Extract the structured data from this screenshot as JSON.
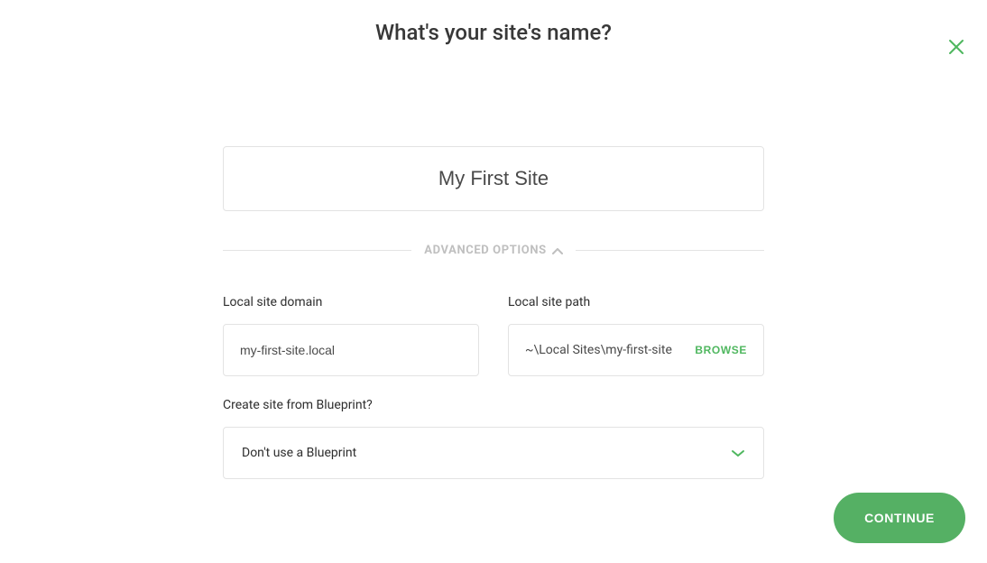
{
  "title": "What's your site's name?",
  "site_name": "My First Site",
  "advanced_label": "ADVANCED OPTIONS",
  "domain": {
    "label": "Local site domain",
    "value": "my-first-site.local"
  },
  "path": {
    "label": "Local site path",
    "value": "~\\Local Sites\\my-first-site",
    "browse_label": "BROWSE"
  },
  "blueprint": {
    "label": "Create site from Blueprint?",
    "selected": "Don't use a Blueprint"
  },
  "continue_label": "CONTINUE",
  "colors": {
    "accent": "#4fb75f",
    "button": "#55b064",
    "border": "#e3e3e3",
    "muted": "#bfbfbf"
  }
}
